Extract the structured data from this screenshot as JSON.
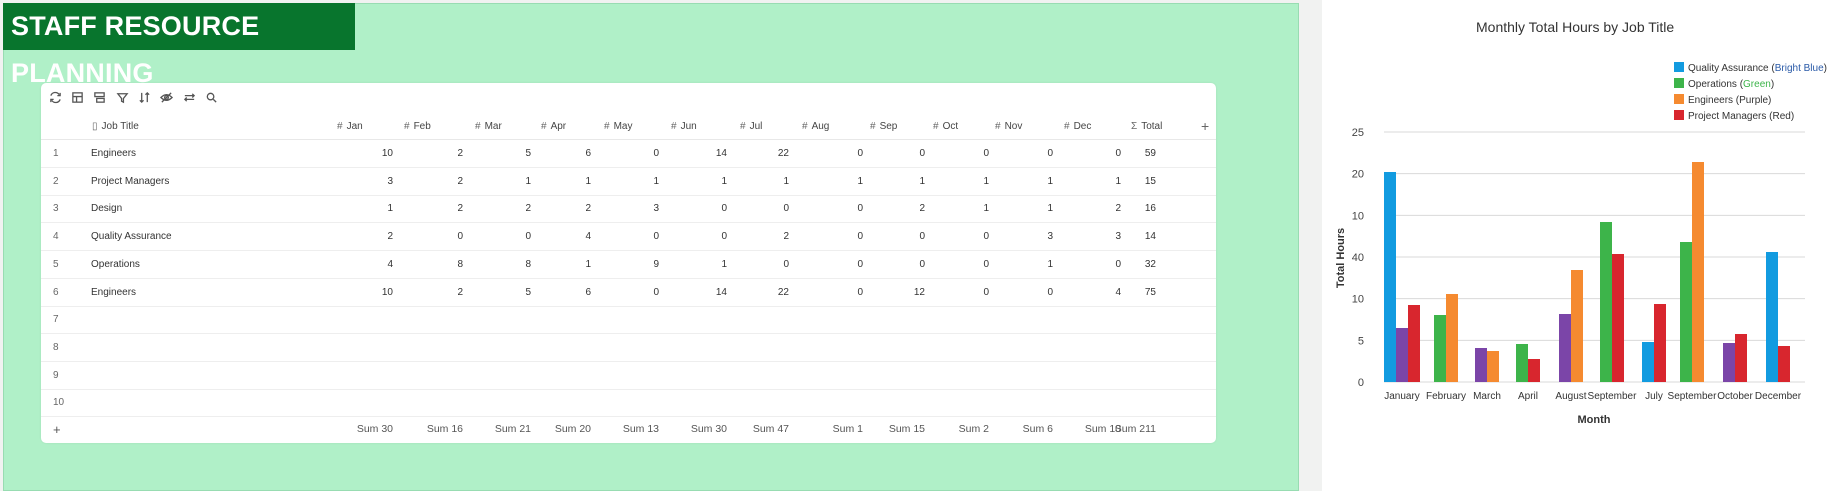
{
  "banner": {
    "title": "STAFF RESOURCE PLANNING"
  },
  "toolbar": {
    "icons": [
      "refresh-icon",
      "table-view-icon",
      "group-icon",
      "filter-icon",
      "sort-icon",
      "hide-fields-icon",
      "row-height-icon",
      "search-icon"
    ]
  },
  "table": {
    "columns": [
      {
        "label": "Job Title",
        "type": "title"
      },
      {
        "label": "Jan"
      },
      {
        "label": "Feb"
      },
      {
        "label": "Mar"
      },
      {
        "label": "Apr"
      },
      {
        "label": "May"
      },
      {
        "label": "Jun"
      },
      {
        "label": "Jul"
      },
      {
        "label": "Aug"
      },
      {
        "label": "Sep"
      },
      {
        "label": "Oct"
      },
      {
        "label": "Nov"
      },
      {
        "label": "Dec"
      },
      {
        "label": "Total",
        "type": "total"
      }
    ],
    "add_column_label": "+",
    "rows": [
      {
        "num": "1",
        "title": "Engineers",
        "values": [
          "10",
          "2",
          "5",
          "6",
          "0",
          "14",
          "22",
          "0",
          "0",
          "0",
          "0",
          "0",
          "59"
        ]
      },
      {
        "num": "2",
        "title": "Project Managers",
        "values": [
          "3",
          "2",
          "1",
          "1",
          "1",
          "1",
          "1",
          "1",
          "1",
          "1",
          "1",
          "1",
          "15"
        ]
      },
      {
        "num": "3",
        "title": "Design",
        "values": [
          "1",
          "2",
          "2",
          "2",
          "3",
          "0",
          "0",
          "0",
          "2",
          "1",
          "1",
          "2",
          "16"
        ]
      },
      {
        "num": "4",
        "title": "Quality Assurance",
        "values": [
          "2",
          "0",
          "0",
          "4",
          "0",
          "0",
          "2",
          "0",
          "0",
          "0",
          "3",
          "3",
          "14"
        ]
      },
      {
        "num": "5",
        "title": "Operations",
        "values": [
          "4",
          "8",
          "8",
          "1",
          "9",
          "1",
          "0",
          "0",
          "0",
          "0",
          "1",
          "0",
          "32"
        ]
      },
      {
        "num": "6",
        "title": "Engineers",
        "values": [
          "10",
          "2",
          "5",
          "6",
          "0",
          "14",
          "22",
          "0",
          "12",
          "0",
          "0",
          "4",
          "75"
        ]
      },
      {
        "num": "7",
        "title": "",
        "values": []
      },
      {
        "num": "8",
        "title": "",
        "values": []
      },
      {
        "num": "9",
        "title": "",
        "values": []
      },
      {
        "num": "10",
        "title": "",
        "values": []
      }
    ],
    "add_row_label": "+",
    "sums": [
      "Sum 30",
      "Sum 16",
      "Sum 21",
      "Sum 20",
      "Sum 13",
      "Sum 30",
      "Sum 47",
      "Sum 1",
      "Sum 15",
      "Sum 2",
      "Sum 6",
      "Sum 10",
      "Sum 211"
    ]
  },
  "chart_data": {
    "type": "bar",
    "title": "Monthly Total Hours by Job Title",
    "xlabel": "Month",
    "ylabel": "Total Hours",
    "yticks": [
      "25",
      "20",
      "10",
      "40",
      "10",
      "5",
      "0"
    ],
    "ylim": [
      0,
      25
    ],
    "legend_position": "top-right",
    "categories": [
      "January",
      "February",
      "March",
      "April",
      "August",
      "September",
      "July",
      "September",
      "October",
      "December"
    ],
    "series": [
      {
        "name": "Quality Assurance",
        "color_note": "Bright Blue",
        "color": "#129be0",
        "values": [
          21,
          null,
          null,
          null,
          null,
          null,
          4,
          null,
          null,
          13
        ]
      },
      {
        "name": "Operations",
        "color_note": "Green",
        "color": "#3db44a",
        "values": [
          null,
          6.7,
          null,
          3.8,
          null,
          16,
          null,
          14,
          null,
          null
        ]
      },
      {
        "name": "Engineers",
        "color_note": "Purple",
        "color": "#f58a30",
        "values": [
          null,
          8.8,
          3.1,
          null,
          11.2,
          null,
          null,
          22,
          null,
          null
        ]
      },
      {
        "name": "Project Managers",
        "color_note": "",
        "label_suffix": "(Red)",
        "color": "#d8262e",
        "values": [
          7.7,
          null,
          null,
          2.3,
          null,
          12.8,
          7.8,
          null,
          4.8,
          3.6
        ]
      },
      {
        "name": "",
        "color": "#7b45a8",
        "values": [
          5.4,
          null,
          3.4,
          null,
          6.8,
          null,
          null,
          null,
          3.9,
          null
        ]
      }
    ],
    "legend_labels": [
      {
        "main": "Quality Assurance (",
        "note": "Bright Blue",
        "close": ")",
        "color": "#129be0",
        "note_color": "#2a5aa8"
      },
      {
        "main": "Operations (",
        "note": "Green",
        "close": ")",
        "color": "#3db44a",
        "note_color": "#3db44a"
      },
      {
        "main": "Engineers (Purple)",
        "note": "",
        "close": "",
        "color": "#f58a30",
        "note_color": ""
      },
      {
        "main": "Project Managers (Red)",
        "note": "",
        "close": "",
        "color": "#d8262e",
        "note_color": ""
      }
    ]
  }
}
